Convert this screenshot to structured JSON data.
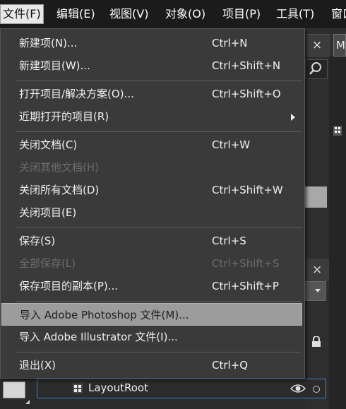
{
  "menubar": {
    "items": [
      {
        "label": "文件(F)",
        "active": true
      },
      {
        "label": "编辑(E)"
      },
      {
        "label": "视图(V)"
      },
      {
        "label": "对象(O)"
      },
      {
        "label": "项目(P)"
      },
      {
        "label": "工具(T)"
      },
      {
        "label": "窗口"
      }
    ]
  },
  "file_menu": {
    "items": [
      {
        "label": "新建项(N)...",
        "shortcut": "Ctrl+N"
      },
      {
        "label": "新建项目(W)...",
        "shortcut": "Ctrl+Shift+N"
      },
      {
        "label": "打开项目/解决方案(O)...",
        "shortcut": "Ctrl+Shift+O"
      },
      {
        "label": "近期打开的项目(R)",
        "submenu": true
      },
      {
        "label": "关闭文档(C)",
        "shortcut": "Ctrl+W"
      },
      {
        "label": "关闭其他文档(H)",
        "disabled": true
      },
      {
        "label": "关闭所有文档(D)",
        "shortcut": "Ctrl+Shift+W"
      },
      {
        "label": "关闭项目(E)"
      },
      {
        "label": "保存(S)",
        "shortcut": "Ctrl+S"
      },
      {
        "label": "全部保存(L)",
        "shortcut": "Ctrl+Shift+S",
        "disabled": true
      },
      {
        "label": "保存项目的副本(P)...",
        "shortcut": "Ctrl+Shift+P"
      },
      {
        "label": "导入 Adobe Photoshop 文件(M)...",
        "highlighted": true
      },
      {
        "label": "导入 Adobe Illustrator 文件(I)..."
      },
      {
        "label": "退出(X)",
        "shortcut": "Ctrl+Q"
      }
    ]
  },
  "background": {
    "top_panel_label": "M",
    "layers_item": "LayoutRoot"
  },
  "colors": {
    "menu_bg": "#3a3a3a",
    "menubar_bg": "#1b1b1b",
    "highlight": "#9c9c9c",
    "disabled_text": "#6c6c6c"
  }
}
